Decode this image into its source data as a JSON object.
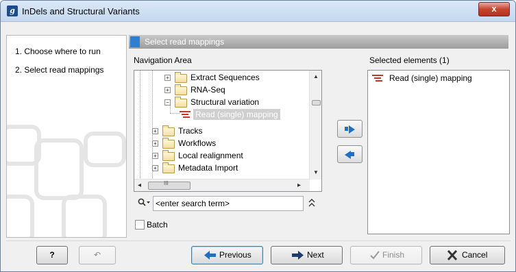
{
  "window": {
    "title": "InDels and Structural Variants",
    "close_label": "x",
    "app_icon_label": "g"
  },
  "steps": [
    {
      "label": "1.  Choose where to run"
    },
    {
      "label": "2.  Select read mappings"
    }
  ],
  "main": {
    "header": "Select read mappings",
    "navigation_label": "Navigation Area",
    "selected_label": "Selected elements (1)"
  },
  "tree": [
    {
      "label": "Extract Sequences",
      "type": "folder",
      "expander": "+"
    },
    {
      "label": "RNA-Seq",
      "type": "folder",
      "expander": "+"
    },
    {
      "label": "Structural variation",
      "type": "folder",
      "expander": "−"
    },
    {
      "label": "Read (single) mapping",
      "type": "read-mapping",
      "selected": true
    },
    {
      "label": "Tracks",
      "type": "folder",
      "expander": "+"
    },
    {
      "label": "Workflows",
      "type": "folder",
      "expander": "+"
    },
    {
      "label": "Local realignment",
      "type": "folder",
      "expander": "+"
    },
    {
      "label": "Metadata Import",
      "type": "folder",
      "expander": "+"
    }
  ],
  "scroll": {
    "up": "▲",
    "down": "▼",
    "left": "◂",
    "right": "▸",
    "grip": "III"
  },
  "search": {
    "placeholder": "<enter search term>",
    "icon": "search-icon",
    "options_glyph": "⌄",
    "collapse_glyph": "≈"
  },
  "selected_elements": [
    {
      "label": "Read (single) mapping",
      "icon": "read-mapping-icon"
    }
  ],
  "batch": {
    "label": "Batch",
    "checked": false
  },
  "buttons": {
    "help": "?",
    "reset": "↶",
    "previous": "Previous",
    "next": "Next",
    "finish": "Finish",
    "cancel": "Cancel"
  },
  "colors": {
    "accent": "#1f6fc3",
    "header_mark": "#2f7fd0",
    "read_mapping_icon": "#c0392b",
    "close_button": "#c7432e"
  }
}
